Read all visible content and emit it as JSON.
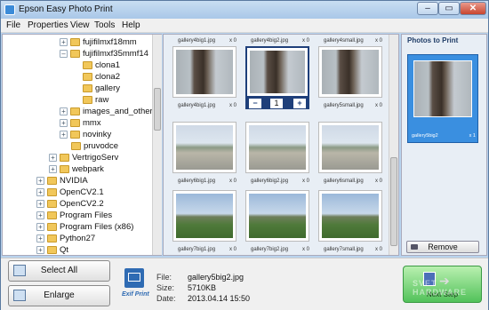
{
  "window": {
    "title": "Epson Easy Photo Print",
    "min_label": "–",
    "max_label": "▭",
    "close_label": "✕"
  },
  "menu": [
    "File",
    "Properties",
    "View",
    "Tools",
    "Help"
  ],
  "tree": [
    {
      "label": "fujifilmxf18mm",
      "expander": "+"
    },
    {
      "label": "fujifilmxf35mmf14",
      "expander": "–"
    },
    {
      "label": "clona1",
      "expander": ""
    },
    {
      "label": "clona2",
      "expander": ""
    },
    {
      "label": "gallery",
      "expander": ""
    },
    {
      "label": "raw",
      "expander": ""
    },
    {
      "label": "images_and_others",
      "expander": "+"
    },
    {
      "label": "mmx",
      "expander": "+"
    },
    {
      "label": "novinky",
      "expander": "+"
    },
    {
      "label": "pruvodce",
      "expander": ""
    },
    {
      "label": "VertrigoServ",
      "expander": "+"
    },
    {
      "label": "webpark",
      "expander": "+"
    },
    {
      "label": "NVIDIA",
      "expander": "+"
    },
    {
      "label": "OpenCV2.1",
      "expander": "+"
    },
    {
      "label": "OpenCV2.2",
      "expander": "+"
    },
    {
      "label": "Program Files",
      "expander": "+"
    },
    {
      "label": "Program Files (x86)",
      "expander": "+"
    },
    {
      "label": "Python27",
      "expander": "+"
    },
    {
      "label": "Qt",
      "expander": "+"
    }
  ],
  "grid": [
    {
      "top": "gallery4big1.jpg",
      "top_count": "x 0",
      "bottom": "gallery4big1.jpg",
      "bottom_count": "x 0",
      "photo": "tree"
    },
    {
      "top": "gallery4big2.jpg",
      "top_count": "x 0",
      "bottom": "",
      "bottom_count": "",
      "photo": "tree",
      "selected": true
    },
    {
      "top": "gallery4small.jpg",
      "top_count": "x 0",
      "bottom": "gallery5small.jpg",
      "bottom_count": "x 0",
      "photo": "tree"
    },
    {
      "top": "",
      "top_count": "",
      "bottom": "gallery6big1.jpg",
      "bottom_count": "x 0",
      "photo": "road"
    },
    {
      "top": "",
      "top_count": "",
      "bottom": "gallery6big2.jpg",
      "bottom_count": "x 0",
      "photo": "road"
    },
    {
      "top": "",
      "top_count": "",
      "bottom": "gallery6small.jpg",
      "bottom_count": "x 0",
      "photo": "road"
    },
    {
      "top": "",
      "top_count": "",
      "bottom": "gallery7big1.jpg",
      "bottom_count": "x 0",
      "photo": "field"
    },
    {
      "top": "",
      "top_count": "",
      "bottom": "gallery7big2.jpg",
      "bottom_count": "x 0",
      "photo": "field"
    },
    {
      "top": "",
      "top_count": "",
      "bottom": "gallery7small.jpg",
      "bottom_count": "x 0",
      "photo": "field"
    }
  ],
  "stepper": {
    "minus": "−",
    "value": "1",
    "plus": "+"
  },
  "print_panel": {
    "header": "Photos to Print",
    "item_name": "gallery5big2",
    "item_count": "x 1",
    "remove_label": "Remove"
  },
  "buttons": {
    "select_all": "Select All",
    "enlarge": "Enlarge",
    "next_step": "Next Step"
  },
  "exif_label": "Exif Print",
  "file_info": {
    "file_label": "File:",
    "file_value": "gallery5big2.jpg",
    "size_label": "Size:",
    "size_value": "5710KB",
    "date_label": "Date:",
    "date_value": "2013.04.14 15:50"
  },
  "watermark": "SVET HARDWARE"
}
